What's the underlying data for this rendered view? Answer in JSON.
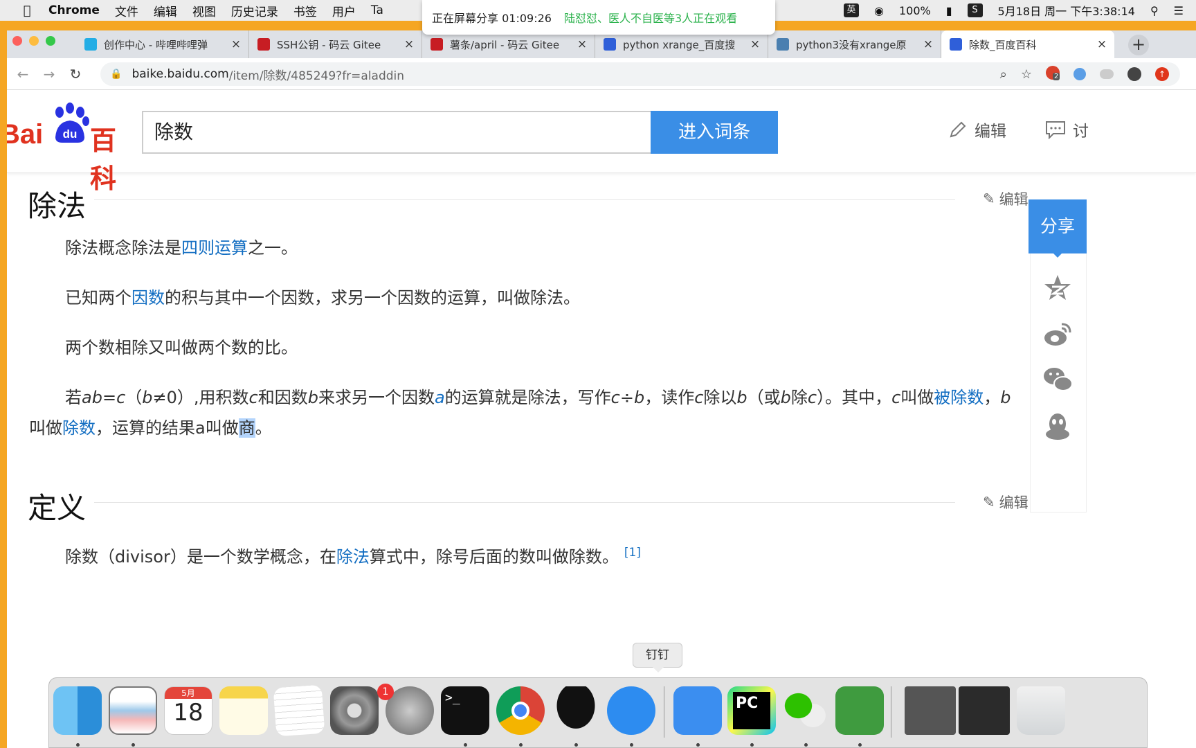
{
  "menubar": {
    "app": "Chrome",
    "items": [
      "文件",
      "编辑",
      "视图",
      "历史记录",
      "书签",
      "用户",
      "Ta"
    ],
    "input_method": "英",
    "battery": "100%",
    "clock": "5月18日 周一 下午3:38:14"
  },
  "share_pill": {
    "time": "正在屏幕分享 01:09:26",
    "viewers": "陆怼怼、医人不自医等3人正在观看"
  },
  "tabs": [
    {
      "title": "创作中心 - 哔哩哔哩弹",
      "color": "#23ade5"
    },
    {
      "title": "SSH公钥 - 码云 Gitee",
      "color": "#c71d23"
    },
    {
      "title": "薯条/april - 码云 Gitee",
      "color": "#c71d23"
    },
    {
      "title": "python xrange_百度搜",
      "color": "#2f5fd9"
    },
    {
      "title": "python3没有xrange原",
      "color": "#4a7fb0"
    },
    {
      "title": "除数_百度百科",
      "color": "#2f5fd9",
      "active": true
    }
  ],
  "address": {
    "host": "baike.baidu.com",
    "path": "/item/除数/485249?fr=aladdin"
  },
  "extensions": {
    "badge": "2"
  },
  "header": {
    "logo_bai": "Bai",
    "logo_du": "du",
    "logo_baike": "百科",
    "search_value": "除数",
    "search_button": "进入词条",
    "edit": "编辑",
    "discuss": "讨"
  },
  "sections": [
    {
      "title": "除法",
      "edit": "编辑"
    },
    {
      "title": "定义",
      "edit": "编辑"
    }
  ],
  "content": {
    "p1_a": "除法概念除法是",
    "p1_link": "四则运算",
    "p1_b": "之一。",
    "p2_a": "已知两个",
    "p2_link": "因数",
    "p2_b": "的积与其中一个因数，求另一个因数的运算，叫做除法。",
    "p3": "两个数相除又叫做两个数的比。",
    "p4_1": "若",
    "p4_ab": "ab",
    "p4_2": "=",
    "p4_c": "c",
    "p4_3": "（",
    "p4_b": "b",
    "p4_4": "≠0）,用积数",
    "p4_c2": "c",
    "p4_5": "和因数",
    "p4_b2": "b",
    "p4_6": "来求另一个因数",
    "p4_a": "a",
    "p4_7": "的运算就是除法，写作",
    "p4_expr": "c÷b",
    "p4_8": "，读作",
    "p4_c3": "c",
    "p4_9": "除以",
    "p4_b3": "b",
    "p4_10": "（或",
    "p4_b4": "b",
    "p4_11": "除",
    "p4_c4": "c",
    "p4_12": "）。其中，",
    "p4_c5": "c",
    "p4_13": "叫做",
    "p4_link1": "被除数",
    "p4_14": "，",
    "p4_b5": "b",
    "p4_15": "叫做",
    "p4_link2": "除数",
    "p4_16": "，运算的结果a叫做",
    "p4_sel": "商",
    "p4_17": "。",
    "p5_a": "除数（divisor）是一个数学概念，在",
    "p5_link": "除法",
    "p5_b": "算式中，除号后面的数叫做除数。",
    "p5_ref": "[1]"
  },
  "sidebar": {
    "share": "分享"
  },
  "dock": {
    "tooltip": "钉钉",
    "calendar_month": "5月",
    "calendar_day": "18",
    "prefs_badge": "1",
    "terminal_prompt": ">_",
    "pycharm": "PC"
  }
}
